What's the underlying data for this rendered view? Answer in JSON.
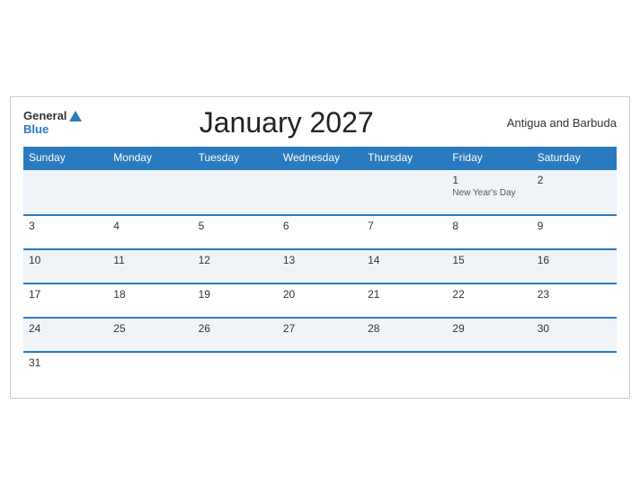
{
  "header": {
    "title": "January 2027",
    "country": "Antigua and Barbuda",
    "logo_general": "General",
    "logo_blue": "Blue"
  },
  "weekdays": [
    "Sunday",
    "Monday",
    "Tuesday",
    "Wednesday",
    "Thursday",
    "Friday",
    "Saturday"
  ],
  "weeks": [
    [
      {
        "day": "",
        "holiday": ""
      },
      {
        "day": "",
        "holiday": ""
      },
      {
        "day": "",
        "holiday": ""
      },
      {
        "day": "",
        "holiday": ""
      },
      {
        "day": "",
        "holiday": ""
      },
      {
        "day": "1",
        "holiday": "New Year's Day"
      },
      {
        "day": "2",
        "holiday": ""
      }
    ],
    [
      {
        "day": "3",
        "holiday": ""
      },
      {
        "day": "4",
        "holiday": ""
      },
      {
        "day": "5",
        "holiday": ""
      },
      {
        "day": "6",
        "holiday": ""
      },
      {
        "day": "7",
        "holiday": ""
      },
      {
        "day": "8",
        "holiday": ""
      },
      {
        "day": "9",
        "holiday": ""
      }
    ],
    [
      {
        "day": "10",
        "holiday": ""
      },
      {
        "day": "11",
        "holiday": ""
      },
      {
        "day": "12",
        "holiday": ""
      },
      {
        "day": "13",
        "holiday": ""
      },
      {
        "day": "14",
        "holiday": ""
      },
      {
        "day": "15",
        "holiday": ""
      },
      {
        "day": "16",
        "holiday": ""
      }
    ],
    [
      {
        "day": "17",
        "holiday": ""
      },
      {
        "day": "18",
        "holiday": ""
      },
      {
        "day": "19",
        "holiday": ""
      },
      {
        "day": "20",
        "holiday": ""
      },
      {
        "day": "21",
        "holiday": ""
      },
      {
        "day": "22",
        "holiday": ""
      },
      {
        "day": "23",
        "holiday": ""
      }
    ],
    [
      {
        "day": "24",
        "holiday": ""
      },
      {
        "day": "25",
        "holiday": ""
      },
      {
        "day": "26",
        "holiday": ""
      },
      {
        "day": "27",
        "holiday": ""
      },
      {
        "day": "28",
        "holiday": ""
      },
      {
        "day": "29",
        "holiday": ""
      },
      {
        "day": "30",
        "holiday": ""
      }
    ],
    [
      {
        "day": "31",
        "holiday": ""
      },
      {
        "day": "",
        "holiday": ""
      },
      {
        "day": "",
        "holiday": ""
      },
      {
        "day": "",
        "holiday": ""
      },
      {
        "day": "",
        "holiday": ""
      },
      {
        "day": "",
        "holiday": ""
      },
      {
        "day": "",
        "holiday": ""
      }
    ]
  ]
}
